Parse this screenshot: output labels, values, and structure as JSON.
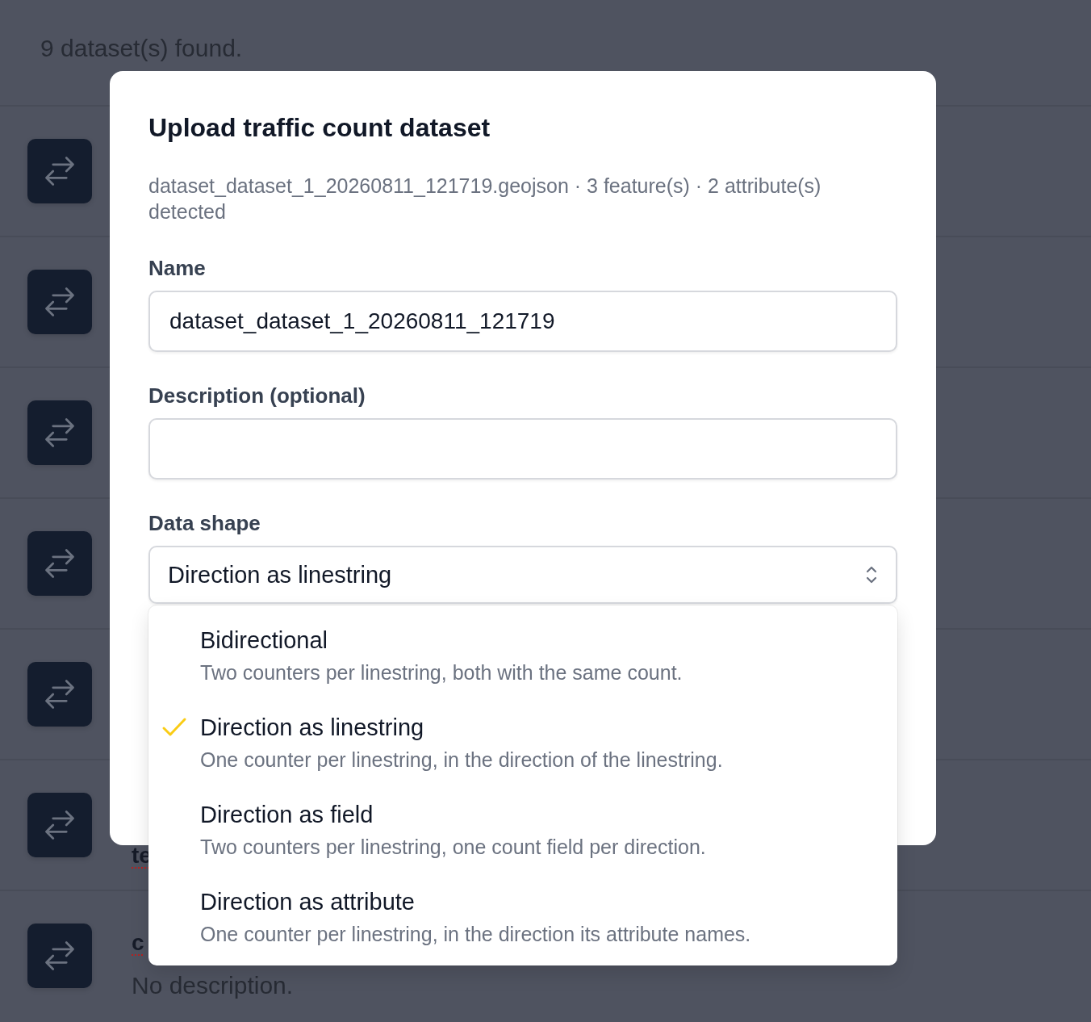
{
  "page": {
    "result_count": "9 dataset(s) found.",
    "datasets": [
      {
        "kind": "count"
      },
      {
        "kind": "count"
      },
      {
        "kind": "count"
      },
      {
        "kind": "count"
      },
      {
        "kind": "count"
      },
      {
        "kind": "count",
        "title": "te"
      },
      {
        "kind": "count",
        "title": "c",
        "description": "No description."
      }
    ]
  },
  "dialog": {
    "title": "Upload traffic count dataset",
    "summary": "dataset_dataset_1_20260811_121719.geojson · 3 feature(s) · 2 attribute(s) detected",
    "fields": [
      {
        "kind": "text",
        "label": "Name",
        "value": "dataset_dataset_1_20260811_121719"
      },
      {
        "kind": "text",
        "label": "Description (optional)"
      },
      {
        "kind": "select",
        "label": "Data shape",
        "value": "Direction as linestring",
        "expanded": true,
        "options": [
          {
            "label": "Bidirectional",
            "description": "Two counters per linestring, both with the same count.",
            "selected": false
          },
          {
            "label": "Direction as linestring",
            "description": "One counter per linestring, in the direction of the linestring.",
            "selected": true
          },
          {
            "label": "Direction as field",
            "description": "Two counters per linestring, one count field per direction.",
            "selected": false
          },
          {
            "label": "Direction as attribute",
            "description": "One counter per linestring, in the direction its attribute names.",
            "selected": false
          }
        ]
      }
    ]
  }
}
